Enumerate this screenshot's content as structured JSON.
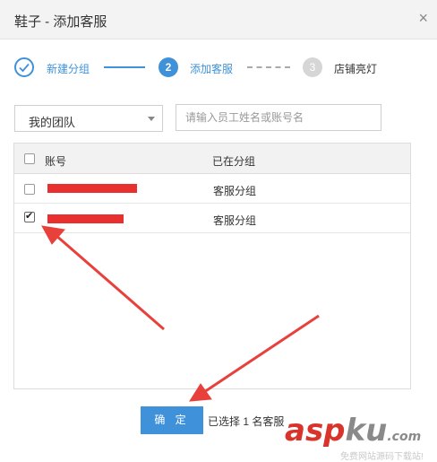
{
  "dialog": {
    "title": "鞋子 - 添加客服",
    "close": "×"
  },
  "steps": [
    {
      "number": "",
      "label": "新建分组",
      "state": "done",
      "icon": "check-icon"
    },
    {
      "number": "2",
      "label": "添加客服",
      "state": "active"
    },
    {
      "number": "3",
      "label": "店铺亮灯",
      "state": "todo"
    }
  ],
  "filters": {
    "team_select": "我的团队",
    "search_placeholder": "请输入员工姓名或账号名"
  },
  "table": {
    "columns": [
      "账号",
      "已在分组"
    ],
    "rows": [
      {
        "account": "",
        "group": "客服分组",
        "checked": false
      },
      {
        "account": "",
        "group": "客服分组",
        "checked": true
      }
    ]
  },
  "footer": {
    "confirm_label": "确 定",
    "selected_text": "已选择 1 名客服"
  },
  "watermark": {
    "brand": "aspku",
    "com": ".com",
    "tagline": "免费网站源码下载站!"
  },
  "colors": {
    "accent": "#3f92d9",
    "redaction": "#e8312f",
    "annotation_arrow": "#e8413c"
  }
}
